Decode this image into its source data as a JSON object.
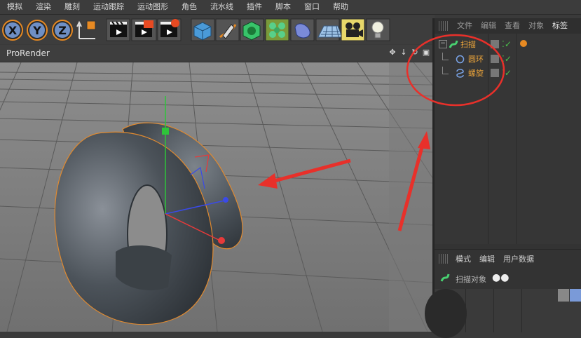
{
  "menu": [
    "模拟",
    "渲染",
    "雕刻",
    "运动跟踪",
    "运动图形",
    "角色",
    "流水线",
    "插件",
    "脚本",
    "窗口",
    "帮助"
  ],
  "viewport": {
    "title": "ProRender"
  },
  "objectManager": {
    "tabs": [
      "文件",
      "编辑",
      "查看",
      "对象",
      "标签"
    ],
    "objects": [
      {
        "name": "扫描",
        "level": 0,
        "icon": "sweep-icon"
      },
      {
        "name": "圆环",
        "level": 1,
        "icon": "circle-spline-icon"
      },
      {
        "name": "螺旋",
        "level": 1,
        "icon": "helix-spline-icon"
      }
    ]
  },
  "attributes": {
    "tabs": [
      "模式",
      "编辑",
      "用户数据"
    ],
    "objectName": "扫描对象"
  },
  "colors": {
    "accent": "#e8a23a",
    "annotation": "#e8302a",
    "selection": "#e08a30"
  }
}
